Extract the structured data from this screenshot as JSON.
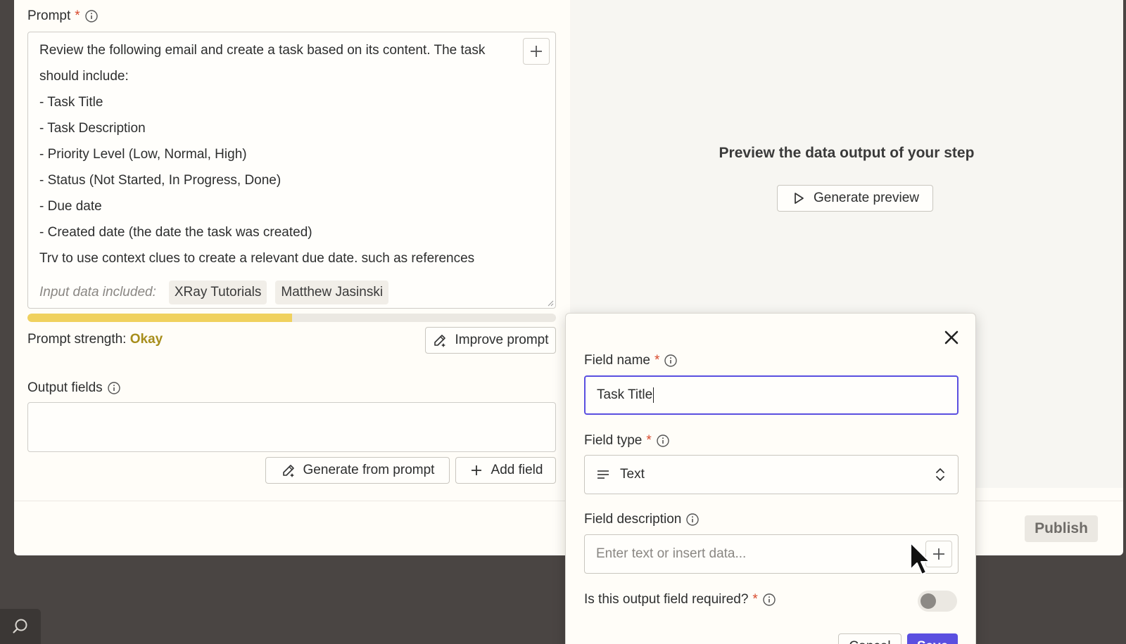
{
  "prompt": {
    "label": "Prompt",
    "required_mark": "*",
    "lines": [
      "Review the following email and create a task based on its content. The task",
      "should include:",
      "- Task Title",
      "- Task Description",
      "- Priority Level (Low, Normal, High)",
      "- Status (Not Started, In Progress, Done)",
      "- Due date",
      "- Created date (the date the task was created)",
      "Trv to use context clues to create a relevant due date. such as references"
    ],
    "input_data_label": "Input data included:",
    "input_chips": [
      "XRay Tutorials",
      "Matthew Jasinski"
    ],
    "strength_label": "Prompt strength:",
    "strength_value": "Okay",
    "strength_fraction": 0.5,
    "improve_label": "Improve prompt"
  },
  "output_fields": {
    "label": "Output fields",
    "generate_label": "Generate from prompt",
    "add_label": "Add field"
  },
  "preview": {
    "title": "Preview the data output of your step",
    "button_label": "Generate preview"
  },
  "publish_label": "Publish",
  "field_editor": {
    "name_label": "Field name",
    "name_value": "Task Title",
    "type_label": "Field type",
    "type_value": "Text",
    "desc_label": "Field description",
    "desc_placeholder": "Enter text or insert data...",
    "required_label": "Is this output field required?",
    "required_on": false,
    "required_mark": "*",
    "cancel_label": "Cancel",
    "save_label": "Save"
  },
  "colors": {
    "accent": "#5a4fe0",
    "strength": "#f0d15e",
    "strength_text": "#a78e1c",
    "required": "#d8492c"
  }
}
